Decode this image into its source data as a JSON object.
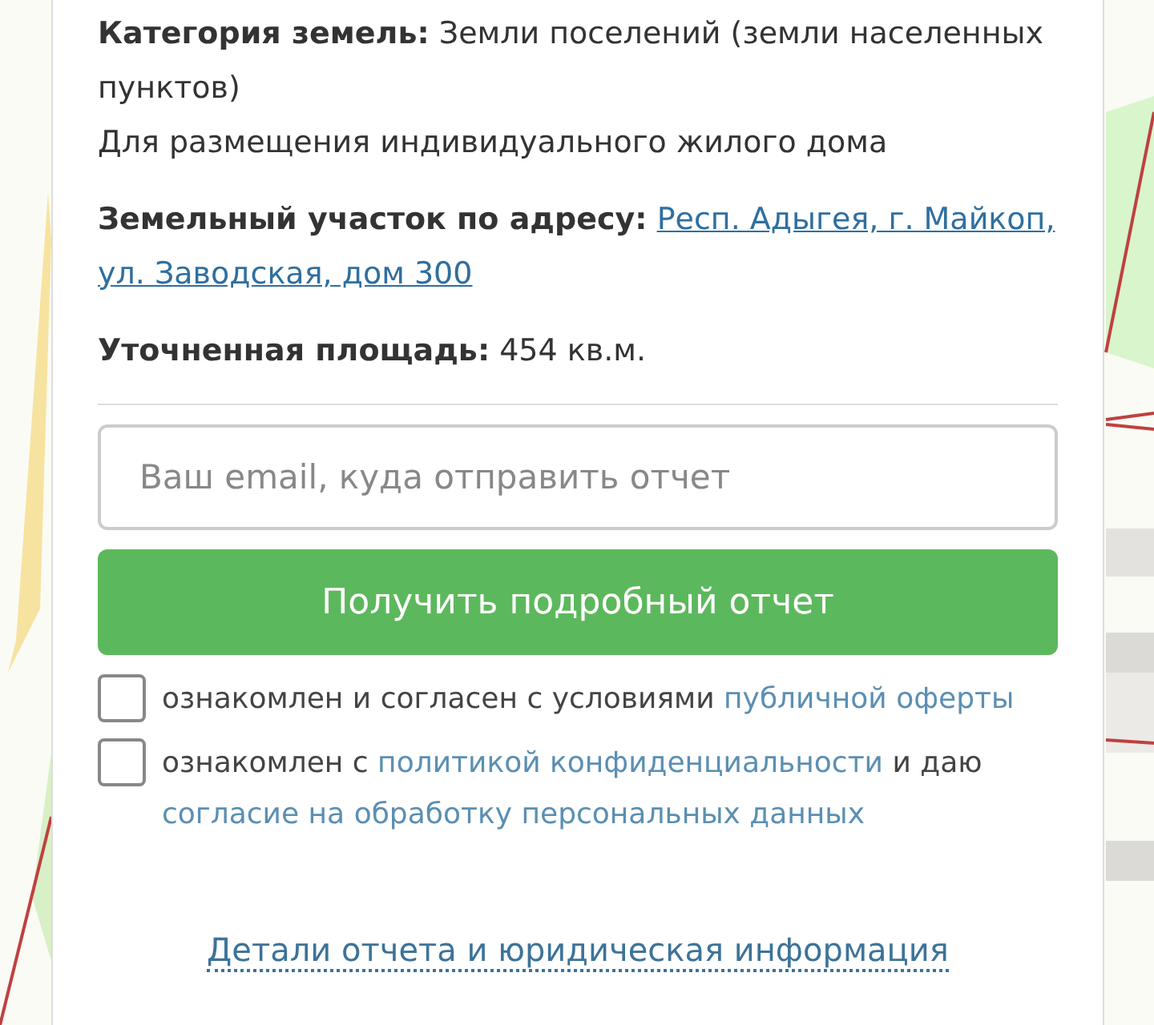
{
  "fields": [
    {
      "kind": "labeled",
      "label": "Категория земель:",
      "value": "Земли поселений (земли населенных пунктов)"
    },
    {
      "kind": "plain",
      "value": "Для размещения индивидуального жилого дома"
    },
    {
      "kind": "link",
      "label": "Земельный участок по адресу:",
      "value": "Респ. Адыгея, г. Майкоп, ул. Заводская, дом 300"
    },
    {
      "kind": "labeled",
      "label": "Уточненная площадь:",
      "value": "454 кв.м."
    }
  ],
  "email_field": {
    "placeholder": "Ваш email, куда отправить отчет"
  },
  "submit_button": "Получить подробный отчет",
  "consents": [
    {
      "checked": false,
      "parts": [
        {
          "kind": "text",
          "text": "ознакомлен и согласен с условиями"
        },
        {
          "kind": "link",
          "text": "публичной оферты"
        }
      ]
    },
    {
      "checked": false,
      "parts": [
        {
          "kind": "text",
          "text": "ознакомлен с"
        },
        {
          "kind": "link",
          "text": "политикой конфиденциальности"
        },
        {
          "kind": "text",
          "text": "и даю"
        },
        {
          "kind": "link",
          "text": "согласие на обработку персональных данных"
        }
      ]
    }
  ],
  "details_link": "Детали отчета и юридическая информация"
}
